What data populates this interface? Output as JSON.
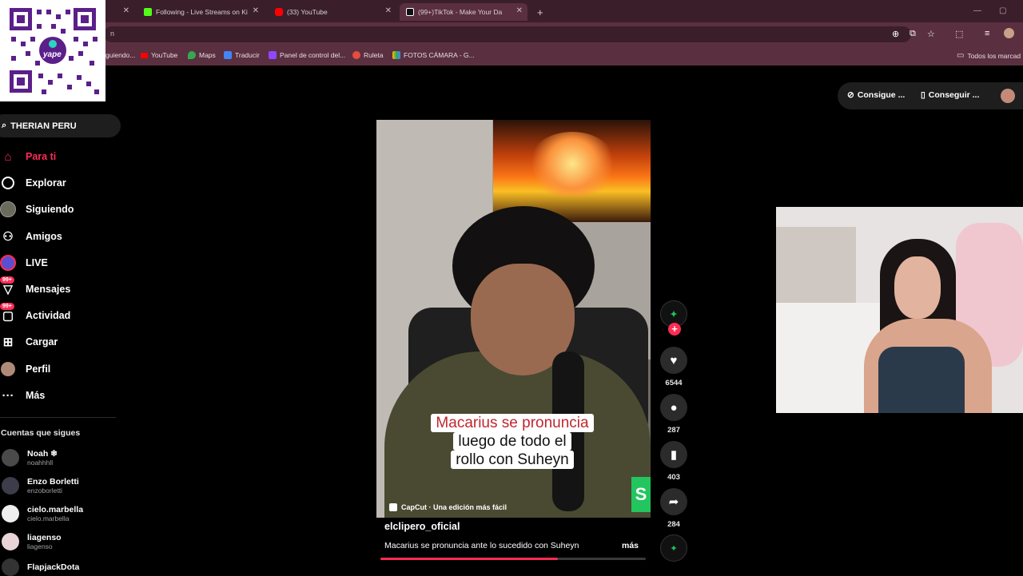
{
  "browser": {
    "tabs": [
      {
        "title": "Following - Live Streams on Ki",
        "color": "#53fc18"
      },
      {
        "title": "(33) YouTube",
        "color": "#ff0000"
      },
      {
        "title": "(99+)TikTok - Make Your Da",
        "color": "#ffffff",
        "active": true
      }
    ],
    "new_tab": "+",
    "url_fragment": "n",
    "bookmarks": [
      {
        "label": "guiendo..."
      },
      {
        "label": "YouTube"
      },
      {
        "label": "Maps"
      },
      {
        "label": "Traducir"
      },
      {
        "label": "Panel de control del..."
      },
      {
        "label": "Ruleta"
      },
      {
        "label": "FOTOS CÁMARA - G..."
      }
    ],
    "all_bookmarks": "Todos los marcad"
  },
  "qr": {
    "brand": "yape"
  },
  "search": {
    "value": "THERIAN PERU"
  },
  "nav": [
    {
      "label": "Para ti",
      "icon": "home-icon",
      "active": true
    },
    {
      "label": "Explorar",
      "icon": "compass-icon"
    },
    {
      "label": "Siguiendo",
      "icon": "following-avatar"
    },
    {
      "label": "Amigos",
      "icon": "friends-icon"
    },
    {
      "label": "LIVE",
      "icon": "live-icon"
    },
    {
      "label": "Mensajes",
      "icon": "messages-icon",
      "badge": "99+"
    },
    {
      "label": "Actividad",
      "icon": "activity-icon",
      "badge": "99+"
    },
    {
      "label": "Cargar",
      "icon": "upload-icon"
    },
    {
      "label": "Perfil",
      "icon": "profile-icon"
    },
    {
      "label": "Más",
      "icon": "more-icon"
    }
  ],
  "following": {
    "title": "Cuentas que sigues",
    "accounts": [
      {
        "name": "Noah ❄",
        "user": "noahhhll"
      },
      {
        "name": "Enzo Borletti",
        "user": "enzoborletti"
      },
      {
        "name": "cielo.marbella",
        "user": "cielo.marbella"
      },
      {
        "name": "liagenso",
        "user": "liagenso"
      },
      {
        "name": "FlapjackDota",
        "user": ""
      }
    ]
  },
  "top_actions": {
    "coins": "Consigue ...",
    "app": "Conseguir ..."
  },
  "video": {
    "caption_line1": "Macarius se pronuncia",
    "caption_line2": "luego de todo el",
    "caption_line3": "rollo con Suheyn",
    "capcut": "CapCut · Una edición más fácil",
    "green_tab": "S",
    "author": "elclipero_oficial",
    "description": "Macarius se pronuncia ante lo sucedido con Suheyn",
    "more": "más",
    "progress": 0.67
  },
  "actions": {
    "likes": "6544",
    "comments": "287",
    "saves": "403",
    "shares": "284"
  },
  "colors": {
    "accent": "#fe2c55",
    "tab_bar": "#3a1f2b",
    "toolbar": "#5a2f40"
  }
}
